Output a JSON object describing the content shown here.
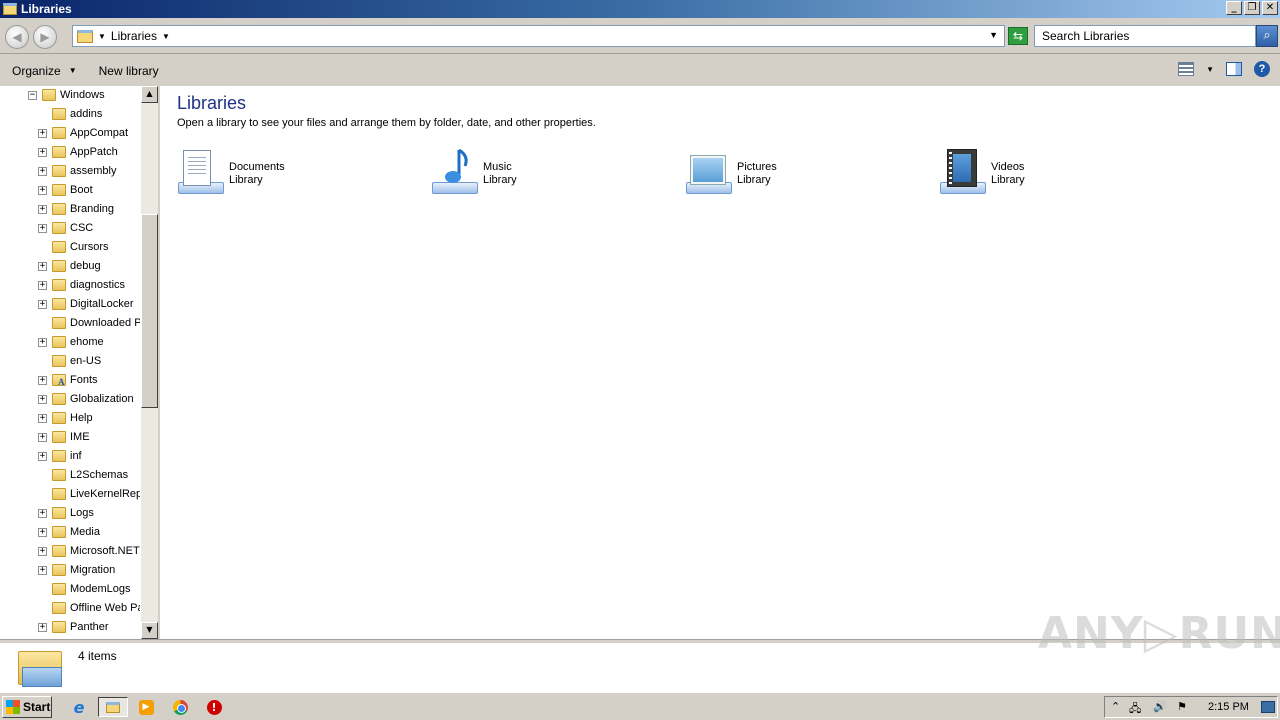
{
  "window": {
    "title": "Libraries",
    "controls": {
      "minimize": "_",
      "restore": "❐",
      "close": "✕"
    }
  },
  "address": {
    "crumb": "Libraries",
    "search_placeholder": "Search Libraries",
    "back_icon": "back-arrow",
    "forward_icon": "forward-arrow"
  },
  "commands": {
    "organize": "Organize",
    "new_library": "New library"
  },
  "tree": {
    "root": "Windows",
    "items": [
      {
        "label": "addins",
        "expandable": false
      },
      {
        "label": "AppCompat",
        "expandable": true
      },
      {
        "label": "AppPatch",
        "expandable": true
      },
      {
        "label": "assembly",
        "expandable": true
      },
      {
        "label": "Boot",
        "expandable": true
      },
      {
        "label": "Branding",
        "expandable": true
      },
      {
        "label": "CSC",
        "expandable": true
      },
      {
        "label": "Cursors",
        "expandable": false
      },
      {
        "label": "debug",
        "expandable": true
      },
      {
        "label": "diagnostics",
        "expandable": true
      },
      {
        "label": "DigitalLocker",
        "expandable": true
      },
      {
        "label": "Downloaded Pr",
        "expandable": false
      },
      {
        "label": "ehome",
        "expandable": true
      },
      {
        "label": "en-US",
        "expandable": false
      },
      {
        "label": "Fonts",
        "expandable": true,
        "special": "fonts"
      },
      {
        "label": "Globalization",
        "expandable": true
      },
      {
        "label": "Help",
        "expandable": true
      },
      {
        "label": "IME",
        "expandable": true
      },
      {
        "label": "inf",
        "expandable": true
      },
      {
        "label": "L2Schemas",
        "expandable": false
      },
      {
        "label": "LiveKernelRepo",
        "expandable": false
      },
      {
        "label": "Logs",
        "expandable": true
      },
      {
        "label": "Media",
        "expandable": true
      },
      {
        "label": "Microsoft.NET",
        "expandable": true
      },
      {
        "label": "Migration",
        "expandable": true
      },
      {
        "label": "ModemLogs",
        "expandable": false
      },
      {
        "label": "Offline Web Pa",
        "expandable": false
      },
      {
        "label": "Panther",
        "expandable": true
      }
    ]
  },
  "content": {
    "title": "Libraries",
    "subtitle": "Open a library to see your files and arrange them by folder, date, and other properties.",
    "libraries": [
      {
        "name": "Documents",
        "type": "Library",
        "icon": "documents-icon"
      },
      {
        "name": "Music",
        "type": "Library",
        "icon": "music-icon"
      },
      {
        "name": "Pictures",
        "type": "Library",
        "icon": "pictures-icon"
      },
      {
        "name": "Videos",
        "type": "Library",
        "icon": "videos-icon"
      }
    ]
  },
  "details": {
    "count": "4 items"
  },
  "watermark": "ANY RUN",
  "taskbar": {
    "start": "Start",
    "clock": "2:15 PM"
  }
}
